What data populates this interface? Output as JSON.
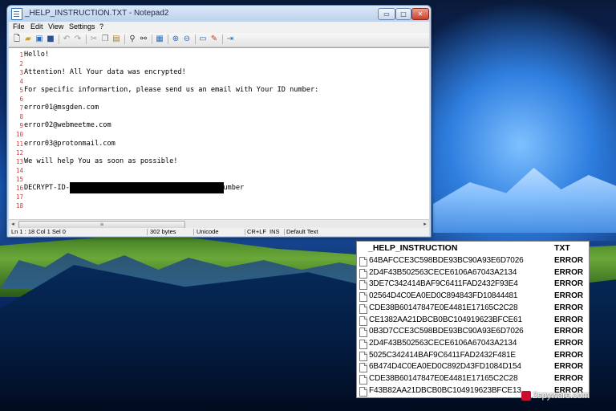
{
  "window": {
    "title": "_HELP_INSTRUCTION.TXT - Notepad2",
    "controls": {
      "minimize": "▭",
      "maximize": "□",
      "close": "✕"
    }
  },
  "menu": {
    "file": "File",
    "edit": "Edit",
    "view": "View",
    "settings": "Settings",
    "help": "?"
  },
  "toolbar": {
    "icons": [
      "new-icon",
      "open-icon",
      "browse-icon",
      "save-icon",
      "undo-icon",
      "redo-icon",
      "cut-icon",
      "copy-icon",
      "paste-icon",
      "find-icon",
      "replace-icon",
      "word-wrap-icon",
      "zoom-in-icon",
      "zoom-out-icon",
      "scheme-icon",
      "customize-icon",
      "exit-icon"
    ]
  },
  "editor": {
    "lines": [
      {
        "n": "1",
        "text": "Hello!"
      },
      {
        "n": "2",
        "text": ""
      },
      {
        "n": "3",
        "text": "Attention! All Your data was encrypted!"
      },
      {
        "n": "4",
        "text": ""
      },
      {
        "n": "5",
        "text": "For specific informartion, please send us an email with Your ID number:"
      },
      {
        "n": "6",
        "text": ""
      },
      {
        "n": "7",
        "text": "error01@msgden.com"
      },
      {
        "n": "8",
        "text": ""
      },
      {
        "n": "9",
        "text": "error02@webmeetme.com"
      },
      {
        "n": "10",
        "text": ""
      },
      {
        "n": "11",
        "text": "error03@protonmail.com"
      },
      {
        "n": "12",
        "text": ""
      },
      {
        "n": "13",
        "text": "We will help You as soon as possible!"
      },
      {
        "n": "14",
        "text": ""
      },
      {
        "n": "15",
        "text": ""
      },
      {
        "n": "16",
        "text": "DECRYPT-ID-                                    number"
      },
      {
        "n": "17",
        "text": ""
      },
      {
        "n": "18",
        "text": ""
      }
    ]
  },
  "statusbar": {
    "position": "Ln 1 : 18   Col 1   Sel 0",
    "size": "302 bytes",
    "encoding": "Unicode",
    "eol": "CR+LF",
    "mode": "INS",
    "scheme": "Default Text"
  },
  "listing": {
    "header_name": "_HELP_INSTRUCTION",
    "header_ext": "TXT",
    "files": [
      {
        "name": "64BAFCCE3C598BDE93BC90A93E6D7026",
        "ext": "ERROR"
      },
      {
        "name": "2D4F43B502563CECE6106A67043A2134",
        "ext": "ERROR"
      },
      {
        "name": "3DE7C342414BAF9C6411FAD2432F93E4",
        "ext": "ERROR"
      },
      {
        "name": "02564D4C0EA0ED0C894843FD10844481",
        "ext": "ERROR"
      },
      {
        "name": "CDE38B60147847E0E4481E17165C2C28",
        "ext": "ERROR"
      },
      {
        "name": "CE1382AA21DBCB0BC104919623BFCE61",
        "ext": "ERROR"
      },
      {
        "name": "0B3D7CCE3C598BDE93BC90A93E6D7026",
        "ext": "ERROR"
      },
      {
        "name": "2D4F43B502563CECE6106A67043A2134",
        "ext": "ERROR"
      },
      {
        "name": "5025C342414BAF9C6411FAD2432F481E",
        "ext": "ERROR"
      },
      {
        "name": "6B474D4C0EA0ED0C892D43FD1084D154",
        "ext": "ERROR"
      },
      {
        "name": "CDE38B60147847E0E4481E17165C2C28",
        "ext": "ERROR"
      },
      {
        "name": "F43B82AA21DBCB0BC104919623BFCE13",
        "ext": "ERROR"
      }
    ]
  },
  "watermark": "2spyware.com",
  "colors": {
    "line_number": "#d23a3a",
    "redaction": "#000000"
  }
}
